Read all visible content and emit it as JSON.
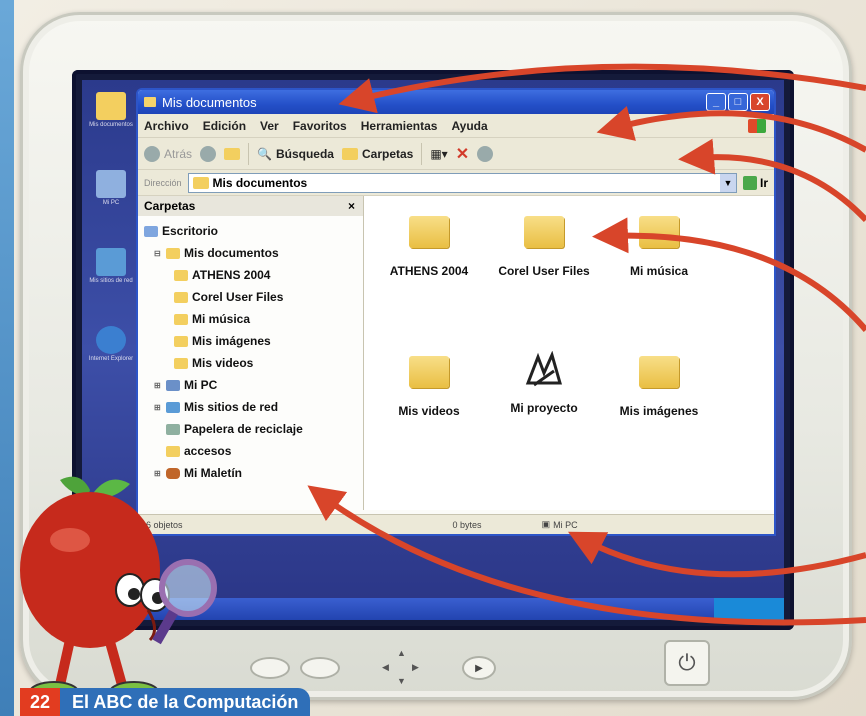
{
  "window": {
    "title": "Mis documentos",
    "controls": {
      "minimize": "_",
      "maximize": "□",
      "close": "X"
    }
  },
  "menu": [
    "Archivo",
    "Edición",
    "Ver",
    "Favoritos",
    "Herramientas",
    "Ayuda"
  ],
  "toolbar": {
    "back": "Atrás",
    "search": "Búsqueda",
    "folders": "Carpetas"
  },
  "address": {
    "label": "Dirección",
    "value": "Mis documentos",
    "go": "Ir"
  },
  "folders_pane": {
    "title": "Carpetas",
    "close": "×",
    "items": [
      {
        "label": "Escritorio"
      },
      {
        "label": "Mis documentos"
      },
      {
        "label": "ATHENS 2004"
      },
      {
        "label": "Corel User Files"
      },
      {
        "label": "Mi música"
      },
      {
        "label": "Mis imágenes"
      },
      {
        "label": "Mis videos"
      },
      {
        "label": "Mi PC"
      },
      {
        "label": "Mis sitios de red"
      },
      {
        "label": "Papelera de reciclaje"
      },
      {
        "label": "accesos"
      },
      {
        "label": "Mi Maletín"
      }
    ]
  },
  "files": [
    {
      "name": "ATHENS 2004"
    },
    {
      "name": "Corel User Files"
    },
    {
      "name": "Mi música"
    },
    {
      "name": "Mis videos"
    },
    {
      "name": "Mi proyecto"
    },
    {
      "name": "Mis imágenes"
    }
  ],
  "status": {
    "left": "6 objetos",
    "size": "0 bytes",
    "location": "Mi PC"
  },
  "desktop_icons": [
    {
      "label": "Mis documentos"
    },
    {
      "label": "Mi PC"
    },
    {
      "label": "Mis sitios de red"
    },
    {
      "label": "Internet Explorer"
    }
  ],
  "footer": {
    "page_number": "22",
    "book_title": "El ABC de la Computación"
  },
  "colors": {
    "arrow": "#d8452a",
    "titlebar": "#2450c8",
    "page_number_bg": "#e23c20",
    "book_title_bg": "#2f6fb8"
  }
}
